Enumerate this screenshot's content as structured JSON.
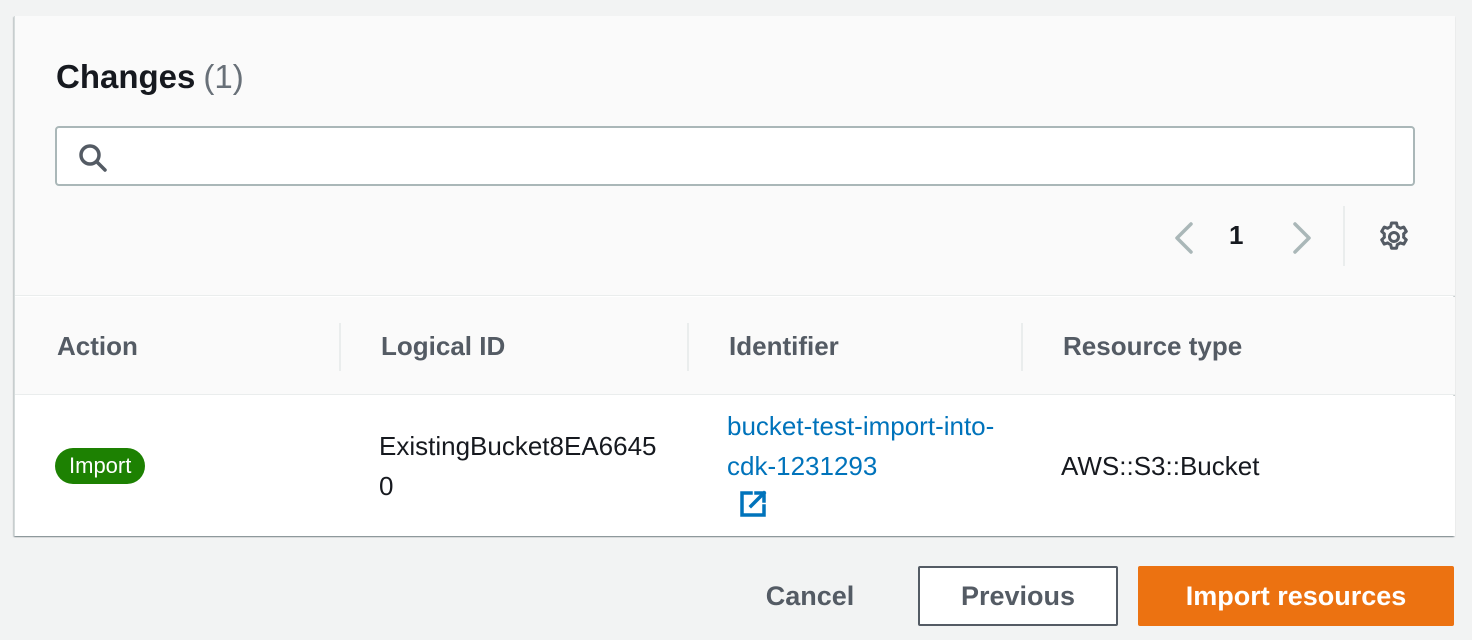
{
  "panel": {
    "title": "Changes",
    "count": "(1)"
  },
  "search": {
    "value": "",
    "placeholder": ""
  },
  "pagination": {
    "current_page": "1"
  },
  "table": {
    "columns": [
      "Action",
      "Logical ID",
      "Identifier",
      "Resource type"
    ],
    "rows": [
      {
        "action": "Import",
        "logical_id": "ExistingBucket8EA66450",
        "identifier": "bucket-test-import-into-cdk-1231293",
        "resource_type": "AWS::S3::Bucket"
      }
    ]
  },
  "footer": {
    "cancel_label": "Cancel",
    "previous_label": "Previous",
    "import_label": "Import resources"
  },
  "colors": {
    "badge_success": "#1d8102",
    "link": "#0073bb",
    "primary_button": "#ec7211"
  },
  "icons": [
    "search-icon",
    "chevron-left-icon",
    "chevron-right-icon",
    "gear-icon",
    "external-link-icon"
  ]
}
